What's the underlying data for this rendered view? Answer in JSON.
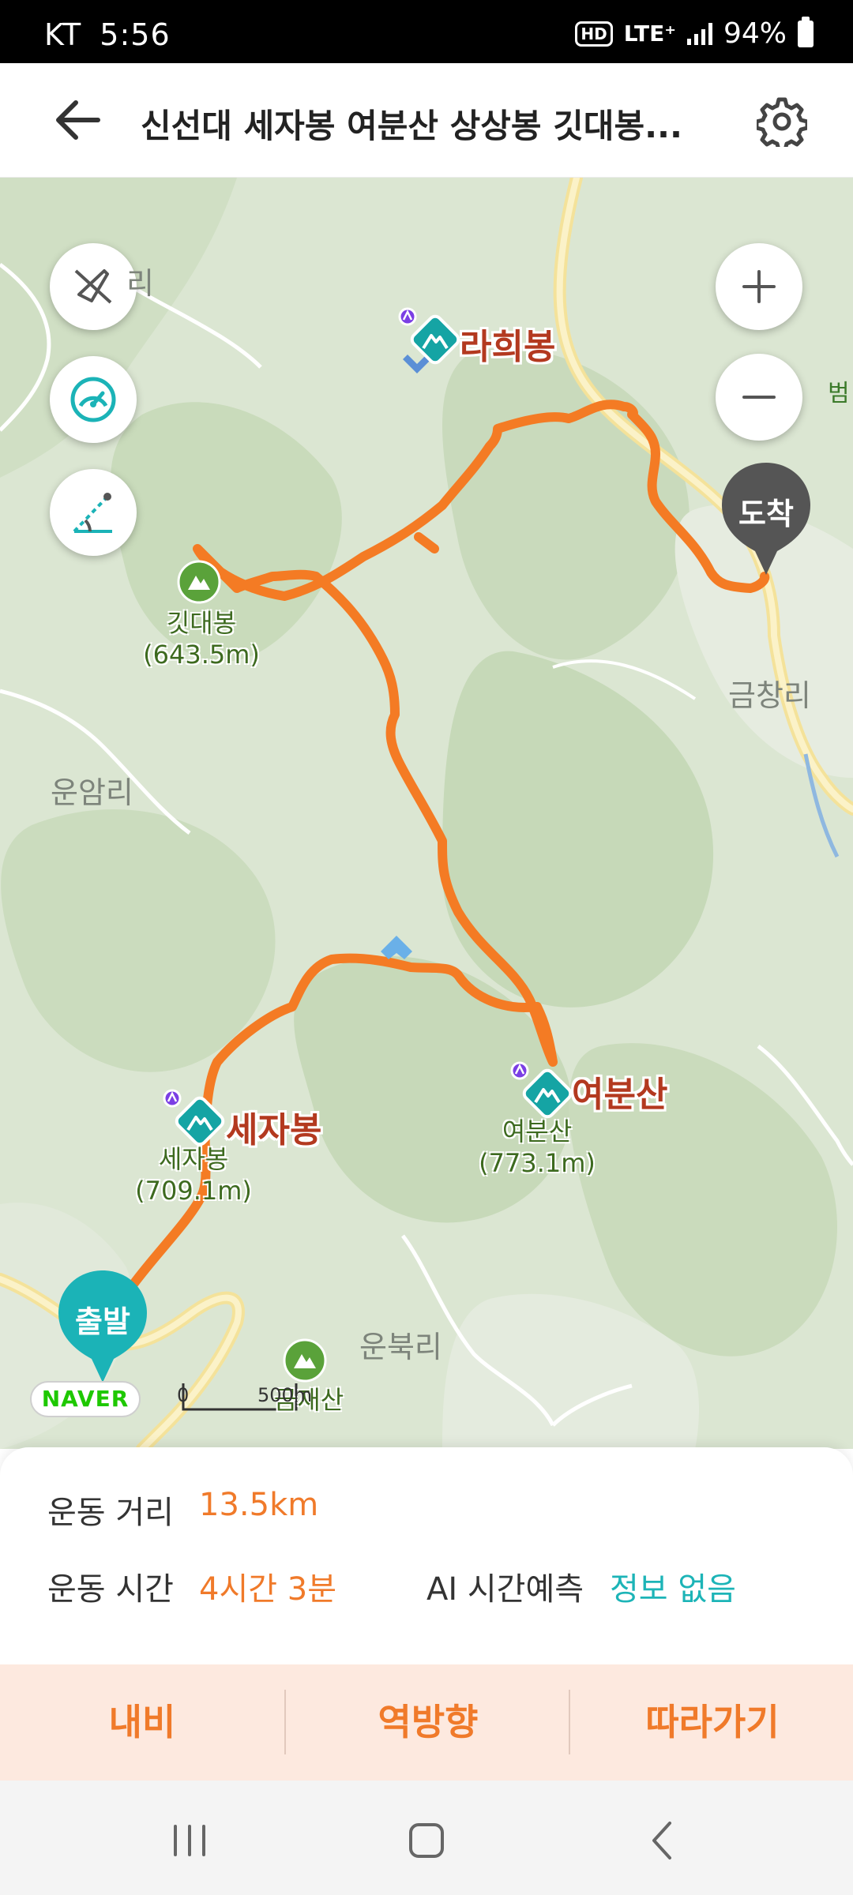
{
  "status_bar": {
    "carrier": "KT",
    "time": "5:56",
    "hd": "HD",
    "network": "LTE⁺",
    "battery": "94%"
  },
  "header": {
    "title": "신선대 세자봉 여분산 상상봉 깃대봉...",
    "back_icon": "arrow-left-icon",
    "settings_icon": "gear-icon"
  },
  "map": {
    "place_labels": {
      "ri_top_left": "리",
      "unamri": "운암리",
      "geumchangri": "금창리",
      "unbukri": "운북리",
      "beom": "범"
    },
    "peaks": {
      "rahuibong": "라희봉",
      "gitdaebong_name": "깃대봉",
      "gitdaebong_elev": "(643.5m)",
      "sejabong": "세자봉",
      "sejabong_sub_name": "세자봉",
      "sejabong_sub_elev": "(709.1m)",
      "yeobunsan": "여분산",
      "yeobunsan_sub_name": "여분산",
      "yeobunsan_sub_elev": "(773.1m)",
      "gusan": "금재산"
    },
    "start_pin": "출발",
    "end_pin": "도착",
    "logo": "NAVER",
    "scale_zero": "0",
    "scale_distance": "500m",
    "route_color": "#f47b24"
  },
  "info": {
    "distance_label": "운동 거리",
    "distance_value": "13.5km",
    "time_label": "운동 시간",
    "time_value": "4시간 3분",
    "ai_label": "AI 시간예측",
    "ai_value": "정보 없음"
  },
  "actions": {
    "navigate": "내비",
    "reverse": "역방향",
    "follow": "따라가기"
  },
  "colors": {
    "accent_orange": "#f07a2a",
    "accent_teal": "#1cb4b7",
    "pin_teal": "#1bb3b7",
    "pin_gray": "#555555"
  }
}
